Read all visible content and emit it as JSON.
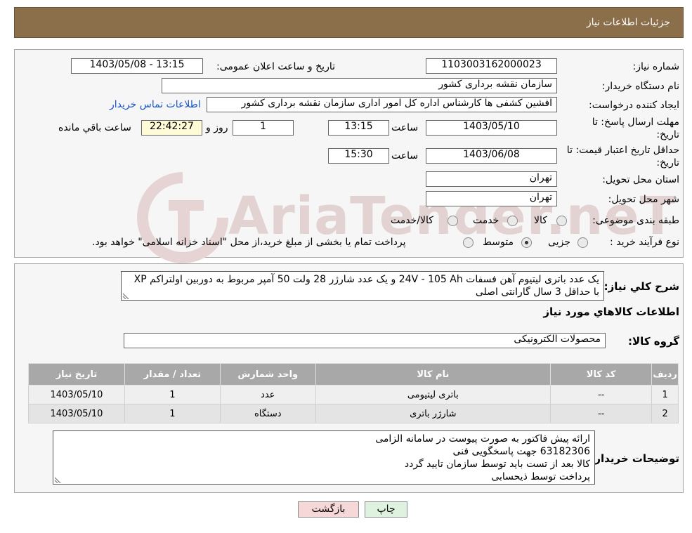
{
  "header": {
    "title": "جزئیات اطلاعات نیاز"
  },
  "fields": {
    "need_number_label": "شماره نیاز:",
    "need_number": "1103003162000023",
    "announce_label": "تاریخ و ساعت اعلان عمومی:",
    "announce_value": "1403/05/08 - 13:15",
    "buyer_label": "نام دستگاه خریدار:",
    "buyer_value": "سازمان نقشه برداری کشور",
    "creator_label": "ایجاد کننده درخواست:",
    "creator_value": "افشین کشفی ها کارشناس اداره کل امور اداری سازمان نقشه برداری کشور",
    "contact_link": "اطلاعات تماس خریدار",
    "deadline_label_1": "مهلت ارسال پاسخ: تا",
    "deadline_label_2": "تاریخ:",
    "deadline_date": "1403/05/10",
    "time_label": "ساعت",
    "deadline_time": "13:15",
    "days_value": "1",
    "days_label": "روز و",
    "remaining_time": "22:42:27",
    "remaining_label": "ساعت باقي مانده",
    "validity_label_1": "حداقل تاريخ اعتبار قيمت: تا",
    "validity_label_2": "تاريخ:",
    "validity_date": "1403/06/08",
    "validity_time": "15:30",
    "province_label": "استان محل تحویل:",
    "province_value": "تهران",
    "city_label": "شهر محل تحویل:",
    "city_value": "تهران",
    "category_label": "طبقه بندی موضوعی:",
    "category_options": [
      "کالا",
      "خدمت",
      "کالا/خدمت"
    ],
    "process_label": "نوع فرآیند خرید :",
    "process_options": [
      "جزیی",
      "متوسط"
    ],
    "process_note": "پرداخت تمام یا بخشی از مبلغ خرید،از محل \"اسناد خزانه اسلامی\" خواهد بود."
  },
  "watermark": {
    "text": "AriaTender.neT"
  },
  "summary": {
    "label": "شرح کلي نياز:",
    "line1": "یک عدد باتری لیتیوم آهن فسفات 24V - 105 Ah و یک عدد شارژر 28 ولت 50 آمپر مربوط به دوربین اولتراکم XP",
    "line2": "با حداقل 3 سال گارانتی اصلی"
  },
  "goods": {
    "section_title": "اطلاعات کالاهاي مورد نياز",
    "group_label": "گروه کالا:",
    "group_value": "محصولات الکترونیکی",
    "columns": [
      "رديف",
      "کد کالا",
      "نام کالا",
      "واحد شمارش",
      "تعداد / مقدار",
      "تاريخ نياز"
    ],
    "rows": [
      [
        "1",
        "--",
        "باتری لیتیومی",
        "عدد",
        "1",
        "1403/05/10"
      ],
      [
        "2",
        "--",
        "شارژر باتری",
        "دستگاه",
        "1",
        "1403/05/10"
      ]
    ]
  },
  "notes": {
    "label": "توضيحات خريدار:",
    "lines": [
      "ارائه پیش فاکتور به صورت پیوست در سامانه الزامی",
      "63182306 جهت پاسخگویی فنی",
      "کالا بعد از تست باید توسط سازمان تایید گردد",
      "پرداخت توسط ذیحسابی"
    ]
  },
  "buttons": {
    "back": "بازگشت",
    "print": "چاپ"
  },
  "colors": {
    "header_bg": "#8b6e4a",
    "link": "#1a56c9",
    "table_header": "#a8a8a8"
  }
}
